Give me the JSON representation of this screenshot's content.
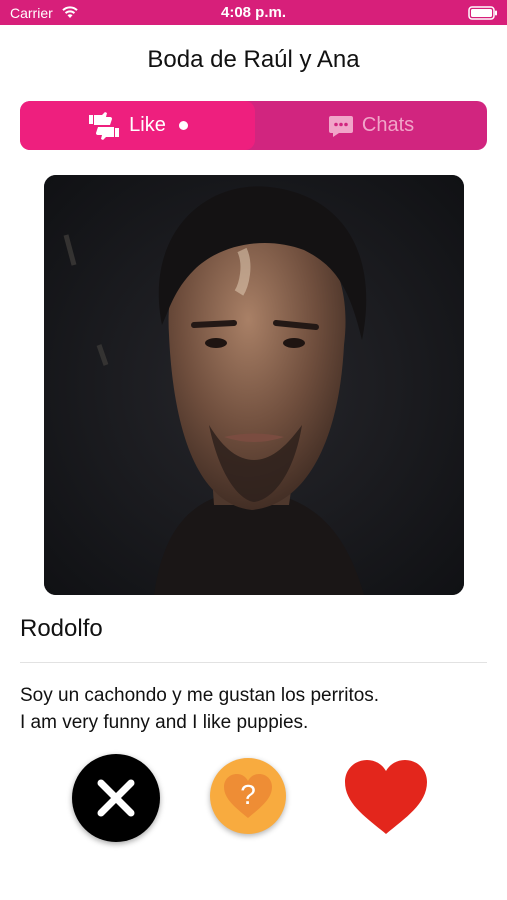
{
  "status_bar": {
    "carrier": "Carrier",
    "time": "4:08 p.m.",
    "background": "#d71f7a"
  },
  "header": {
    "title": "Boda de Raúl y Ana"
  },
  "tabs": [
    {
      "label": "Like",
      "icon": "thumbs-up-down-icon",
      "selected": true,
      "badge": "dot"
    },
    {
      "label": "Chats",
      "icon": "chat-bubble-icon",
      "selected": false
    }
  ],
  "profile": {
    "photo": "portrait-photo",
    "name": "Rodolfo",
    "bio_lines": [
      "Soy un cachondo y me gustan los perritos.",
      "I am very funny and I like puppies."
    ]
  },
  "actions": [
    {
      "name": "dislike",
      "icon": "x-icon",
      "color": "#000000"
    },
    {
      "name": "maybe",
      "icon": "question-heart-icon",
      "color": "#f8ab3f"
    },
    {
      "name": "like",
      "icon": "heart-icon",
      "color": "#e3261c"
    }
  ],
  "colors": {
    "accent": "#ee1f7e",
    "segment_background": "#d1257f",
    "inactive_tab_text": "#f1a5c9"
  }
}
